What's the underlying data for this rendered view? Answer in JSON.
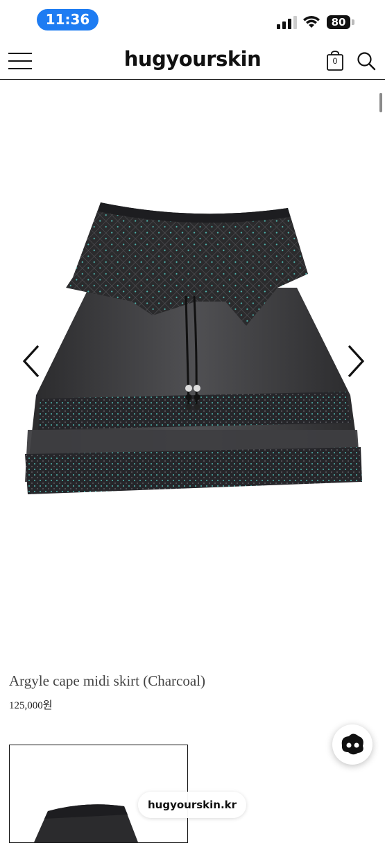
{
  "status_bar": {
    "time": "11:36",
    "battery": "80"
  },
  "header": {
    "logo": "hugyourskin",
    "cart_count": "0"
  },
  "product": {
    "name": "Argyle cape midi skirt (Charcoal)",
    "price": "125,000원"
  },
  "browser": {
    "url": "hugyourskin.kr"
  },
  "colors": {
    "time_pill": "#1e7cf2",
    "skirt": "#2c2c2e",
    "dots": "#4fb7b0"
  }
}
